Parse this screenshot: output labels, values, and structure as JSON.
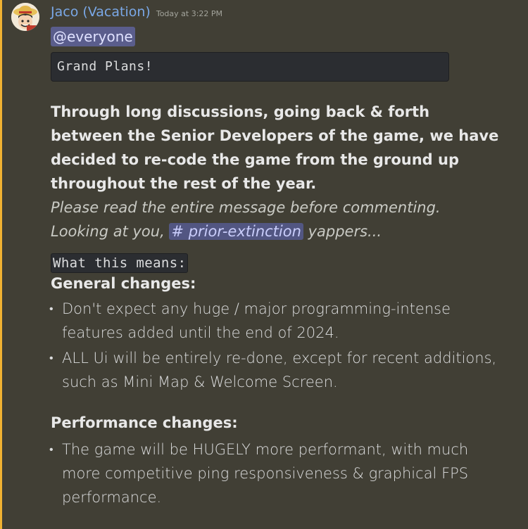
{
  "message": {
    "author": "Jaco (Vacation)",
    "timestamp": "Today at 3:22 PM",
    "mention_everyone": "@everyone",
    "code_title": "Grand Plans!",
    "bold_paragraph": "Through long discussions, going back & forth between the Senior Developers of the game, we have decided to re-code the game from the ground up throughout the rest of the year.",
    "italic_line1": "Please read the entire message before commenting.",
    "italic_line2_prefix": "Looking at you, ",
    "channel_mention": "# prior-extinction",
    "italic_line2_suffix": " yappers...",
    "inline_code": "What this means:",
    "general_heading": "General changes:",
    "general_items": [
      "Don't expect any huge / major programming-intense features added until the end of 2024.",
      "ALL Ui will be entirely re-done, except for recent additions, such as Mini Map & Welcome Screen."
    ],
    "performance_heading": "Performance changes:",
    "performance_items": [
      "The game will be HUGELY more performant, with much more competitive ping responsiveness & graphical FPS performance."
    ]
  },
  "colors": {
    "background": "#413f35",
    "mention_bar": "#f0b232",
    "username": "#7aa8e6",
    "mention_bg": "#5a5d8c"
  },
  "icons": {
    "avatar": "straw-hat-avatar-icon"
  }
}
